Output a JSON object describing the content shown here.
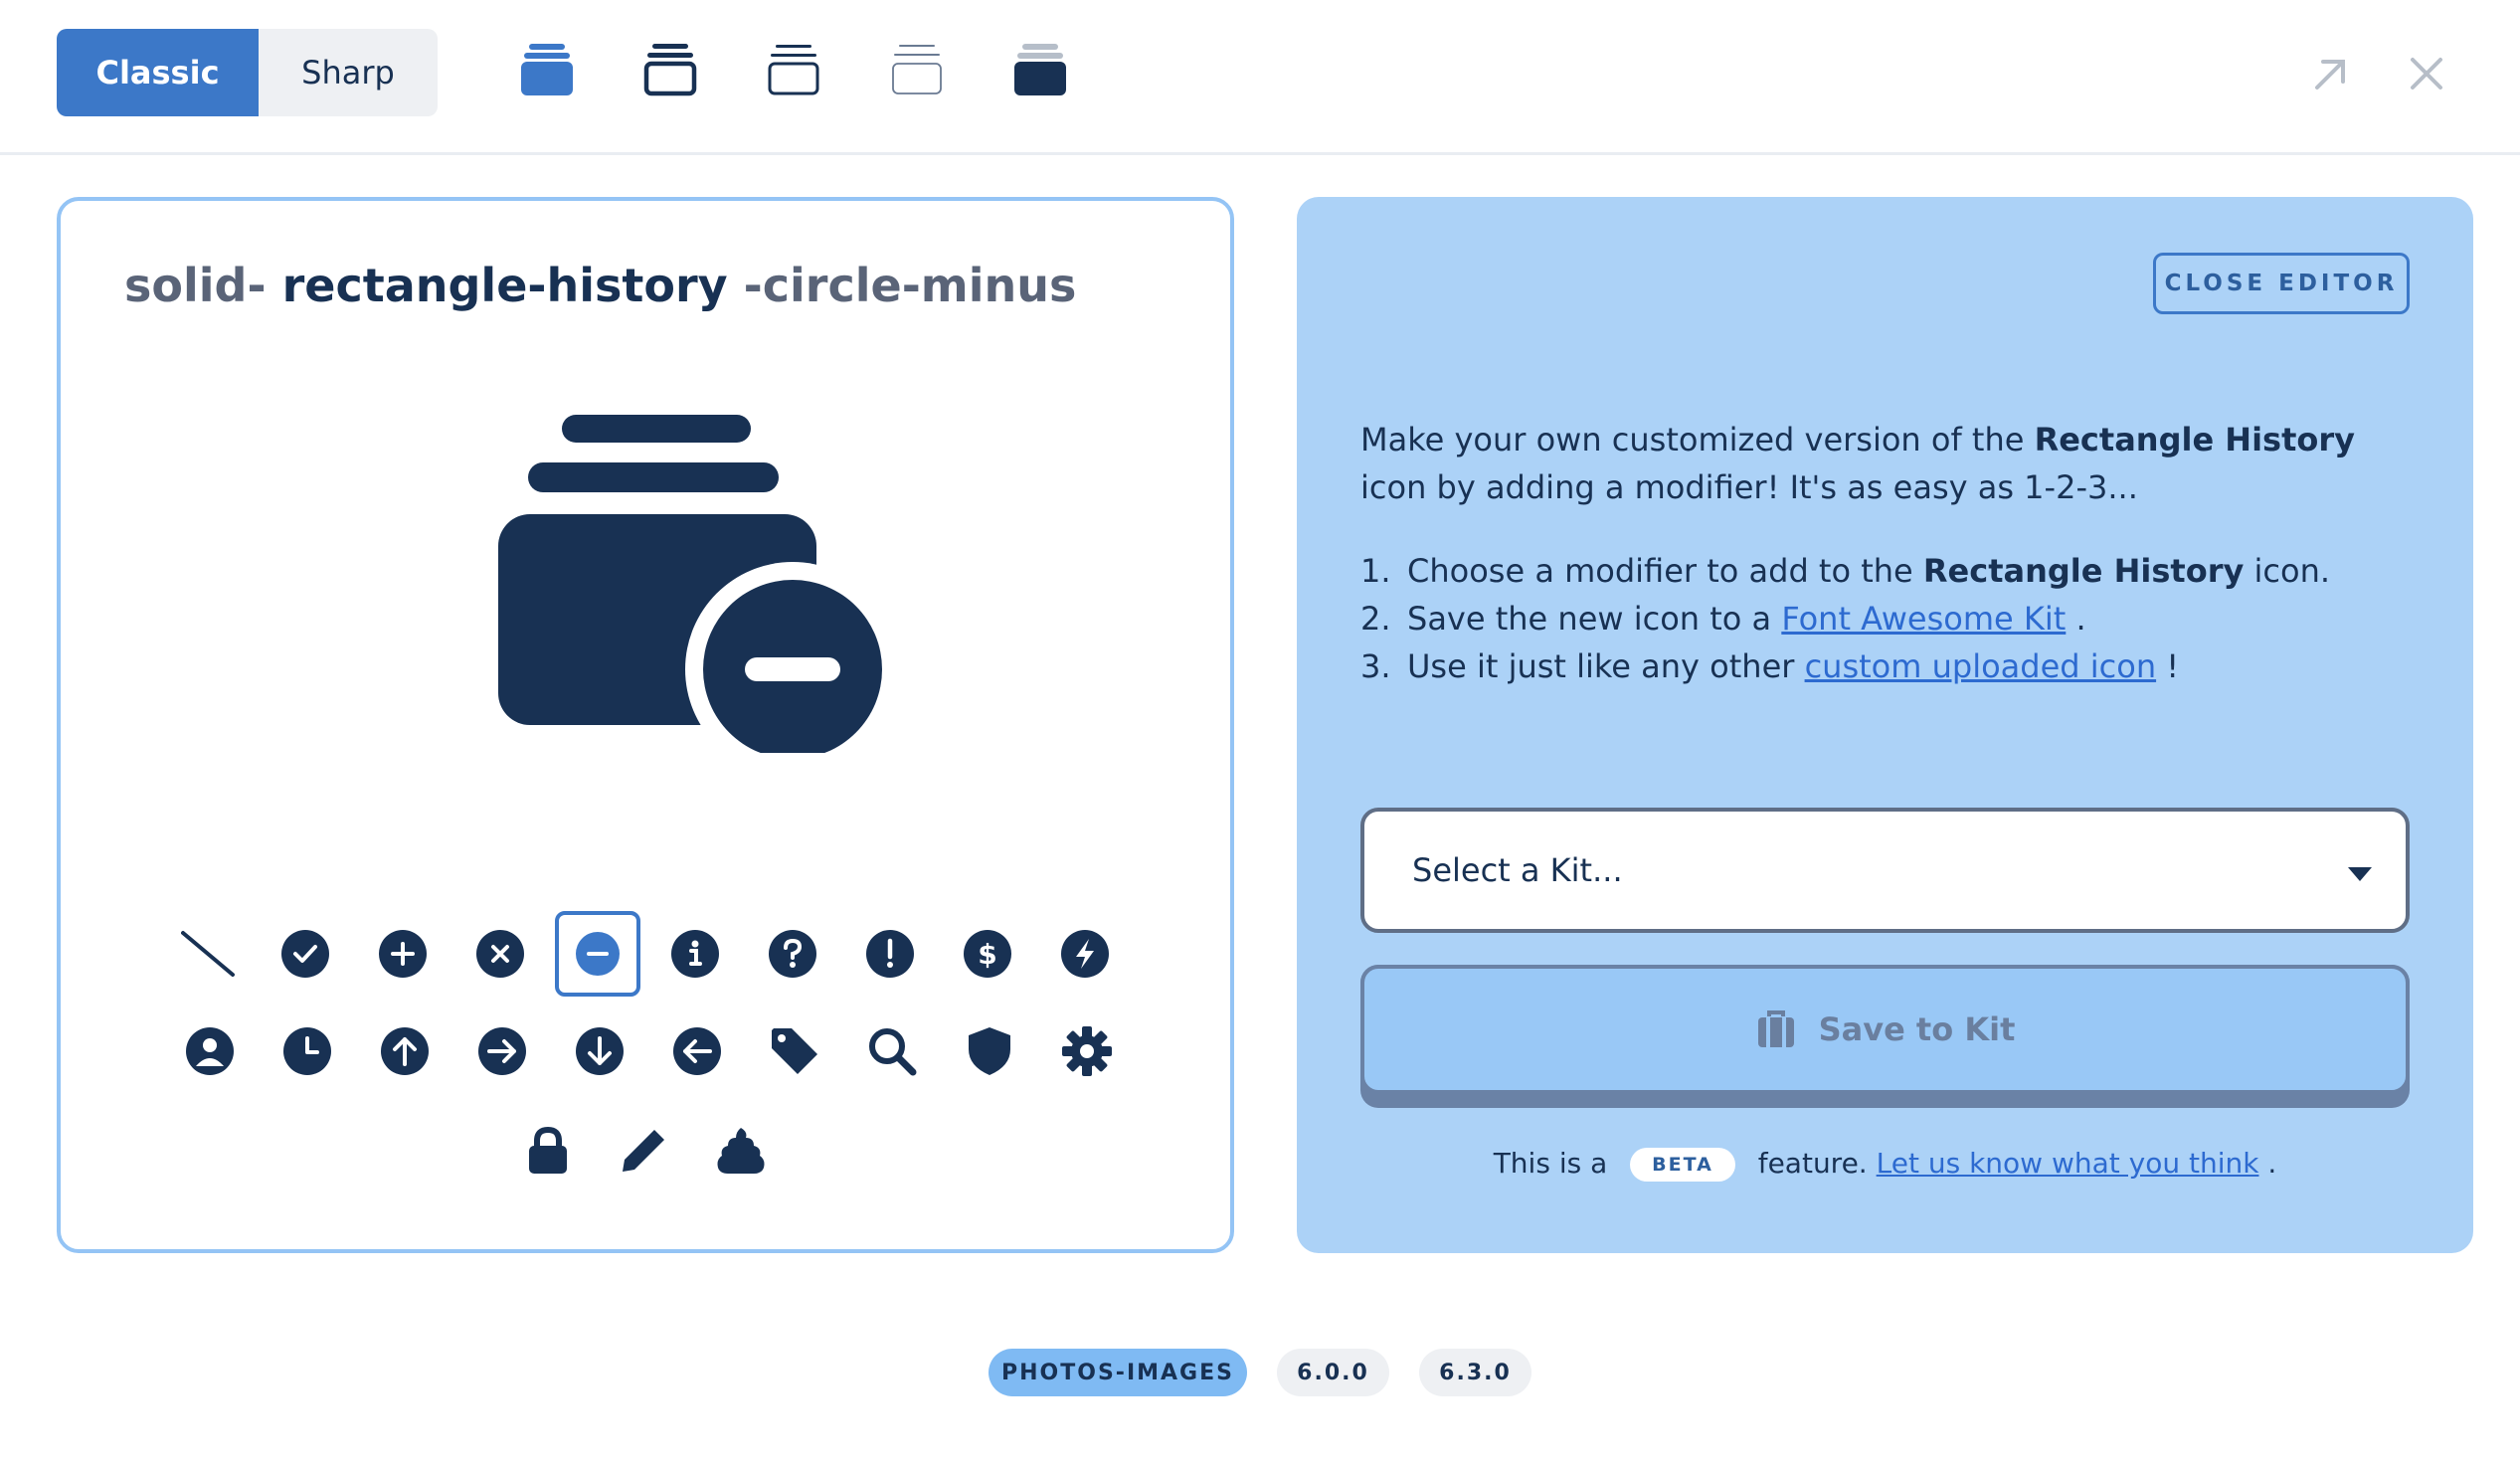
{
  "topbar": {
    "family_classic": "Classic",
    "family_sharp": "Sharp",
    "styles": [
      "solid-style-icon",
      "regular-style-icon",
      "light-style-icon",
      "thin-style-icon",
      "duotone-style-icon"
    ]
  },
  "preview": {
    "name_prefix": "solid-",
    "name_base": "rectangle-history",
    "name_suffix": "-circle-minus"
  },
  "modifiers": {
    "row1": [
      "slash",
      "circle-check",
      "circle-plus",
      "circle-xmark",
      "circle-minus",
      "circle-info",
      "circle-question",
      "circle-exclamation",
      "circle-dollar",
      "circle-bolt"
    ],
    "row2": [
      "circle-user",
      "clock",
      "circle-arrow-up",
      "circle-arrow-right",
      "circle-arrow-down",
      "circle-arrow-left",
      "tag",
      "magnifying-glass",
      "shield",
      "gear"
    ],
    "row3": [
      "lock",
      "pencil",
      "poo"
    ],
    "selected": "circle-minus"
  },
  "editor": {
    "close_label": "CLOSE EDITOR",
    "intro_1": "Make your own customized version of the ",
    "intro_bold": "Rectangle History",
    "intro_2": " icon by adding a modifier! It's as easy as 1-2-3...",
    "step1_num": "1.",
    "step1_a": "Choose a modifier to add to the ",
    "step1_bold": "Rectangle History",
    "step1_b": " icon.",
    "step2_num": "2.",
    "step2_a": "Save the new icon to a ",
    "step2_link": "Font Awesome Kit",
    "step2_b": " .",
    "step3_num": "3.",
    "step3_a": "Use it just like any other ",
    "step3_link": "custom uploaded icon",
    "step3_b": " !",
    "kit_select_placeholder": "Select a Kit...",
    "save_label": "Save to Kit",
    "beta_prefix": "This is a",
    "beta_badge": "BETA",
    "beta_middle": "feature.",
    "beta_link": "Let us know what you think",
    "beta_suffix": " ."
  },
  "tags": {
    "category": "PHOTOS-IMAGES",
    "version_added": "6.0.0",
    "version_updated": "6.3.0"
  },
  "colors": {
    "accent": "#3c78c8",
    "navy": "#183153",
    "editor_bg": "#acd2f7",
    "panel_border": "#94c4f5"
  }
}
